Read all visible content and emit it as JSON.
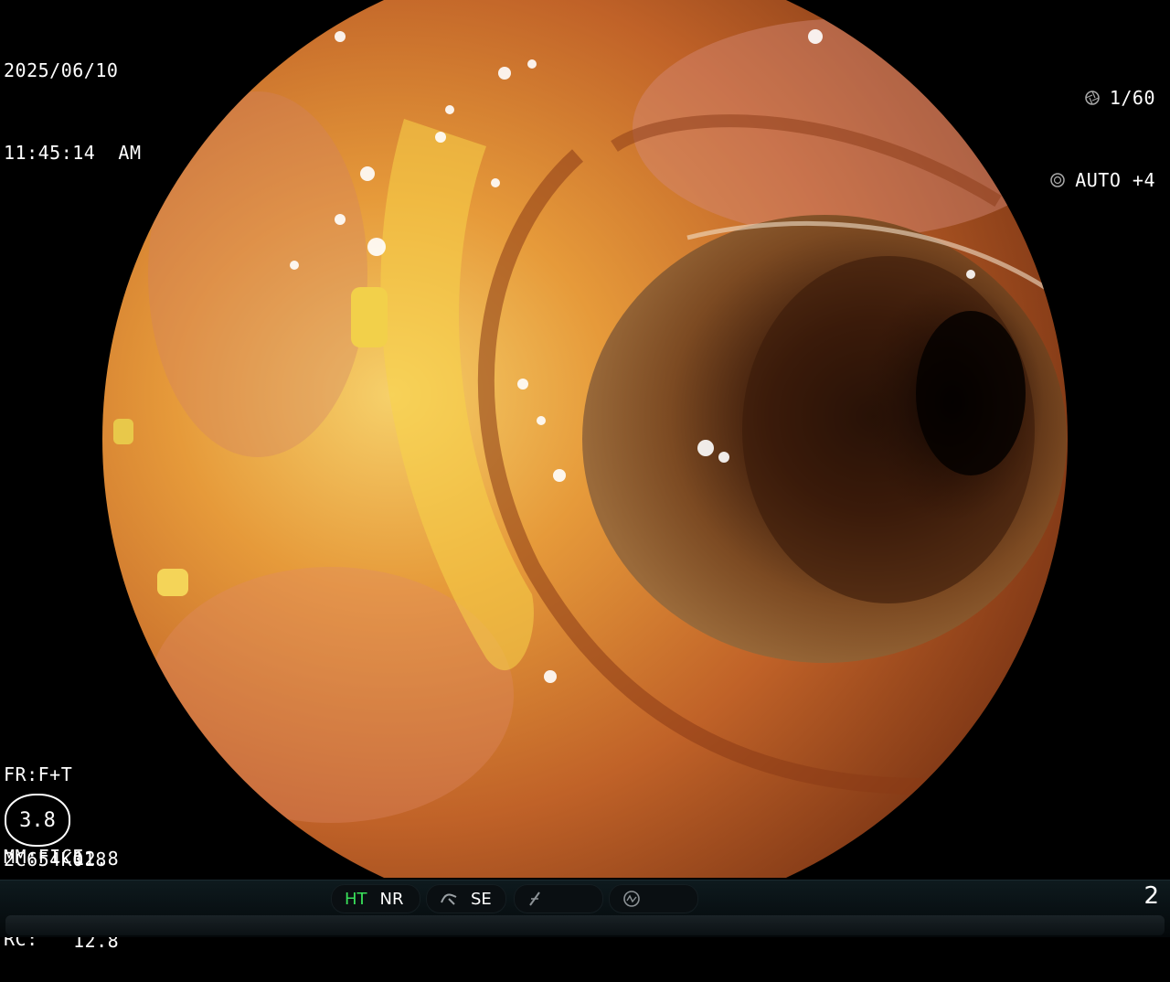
{
  "overlay": {
    "date": "2025/06/10",
    "time": "11:45:14  AM",
    "shutter": "1/60",
    "exposure": "AUTO +4",
    "fr": "FR:F+T",
    "mm": "MM:FICE",
    "rc": "RC:",
    "gauge_value": "3.8",
    "gauge_top": "12.8",
    "gauge_bottom": "12.8",
    "scope_id": "2C654K018"
  },
  "status_bar": {
    "ht": "HT",
    "nr": "NR",
    "se": "SE",
    "page": "2"
  },
  "icons": [
    "shutter-icon",
    "exposure-icon",
    "se-curve-icon",
    "f-icon",
    "circle-wave-icon"
  ],
  "colors": {
    "active_mode": "#39e05a",
    "tissue": "#c8661c",
    "highlight": "#f4c030",
    "lumen": "#1a0a04"
  }
}
